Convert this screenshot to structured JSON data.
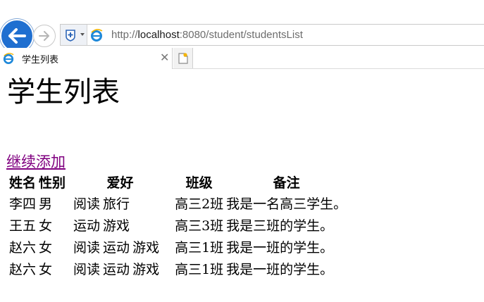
{
  "browser": {
    "url_prefix": "http://",
    "url_host": "localhost",
    "url_rest": ":8080/student/studentsList",
    "tab_title": "学生列表",
    "tab_close_glyph": "✕"
  },
  "page": {
    "title": "学生列表",
    "add_link": "继续添加"
  },
  "table": {
    "headers": [
      "姓名",
      "性别",
      "爱好",
      "",
      "",
      "班级",
      "备注"
    ],
    "rows": [
      [
        "李四",
        "男",
        "阅读",
        "旅行",
        "",
        "高三2班",
        "我是一名高三学生。"
      ],
      [
        "王五",
        "女",
        "运动",
        "游戏",
        "",
        "高三3班",
        "我是三班的学生。"
      ],
      [
        "赵六",
        "女",
        "阅读",
        "运动",
        "游戏",
        "高三1班",
        "我是一班的学生。"
      ],
      [
        "赵六",
        "女",
        "阅读",
        "运动",
        "游戏",
        "高三1班",
        "我是一班的学生。"
      ]
    ]
  },
  "colors": {
    "back_button": "#1f6fd0",
    "visited_link": "#800080"
  },
  "icons": [
    "back-arrow-icon",
    "forward-arrow-icon",
    "compatibility-view-icon",
    "ie-logo-icon",
    "new-tab-icon"
  ]
}
